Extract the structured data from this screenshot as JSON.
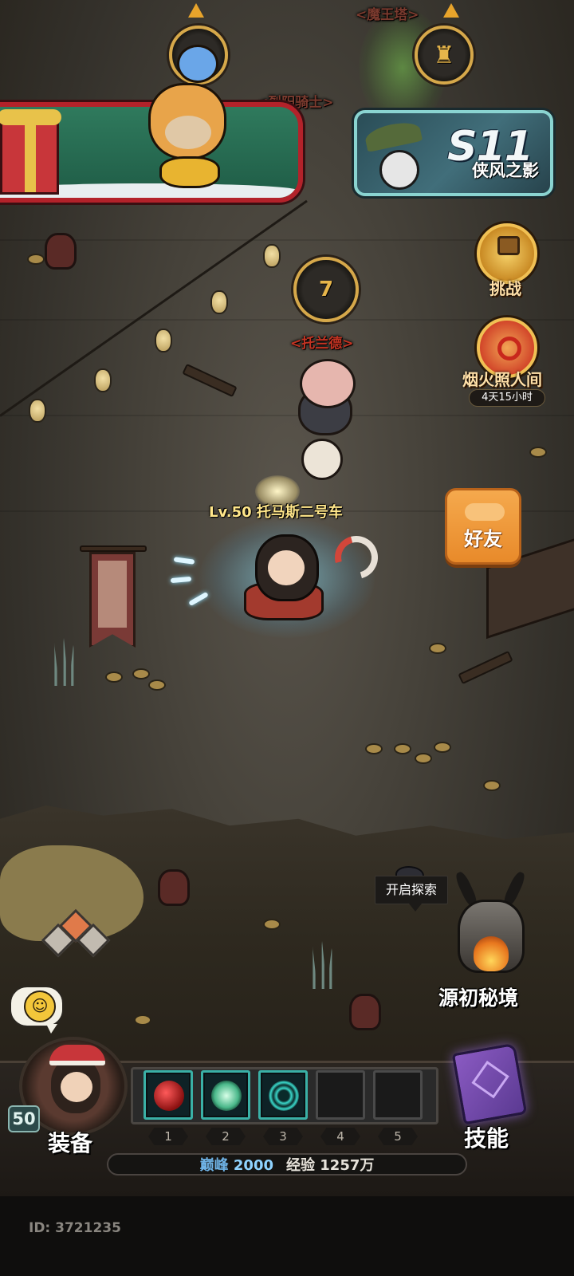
{
  "top": {
    "demon_tower_label": "<魔王塔>",
    "knight_label": "<烈阳骑士>",
    "tolande_label": "<托兰德>"
  },
  "season": {
    "code": "S11",
    "name": "侠风之影"
  },
  "events": {
    "challenge_label": "挑战",
    "fireworks_label": "烟火照人间",
    "fireworks_timer": "4天15小时"
  },
  "friends": {
    "label": "好友"
  },
  "player": {
    "name": "Lv.50 托马斯二号车",
    "level_badge": "50",
    "id": "ID: 3721235"
  },
  "explore": {
    "tooltip": "开启探索",
    "realm_label": "源初秘境"
  },
  "bottom": {
    "equip_label": "装备",
    "skill_label": "技能",
    "slots": [
      {
        "number": "1",
        "filled": true,
        "icon": "red-orb-icon"
      },
      {
        "number": "2",
        "filled": true,
        "icon": "green-lotus-icon"
      },
      {
        "number": "3",
        "filled": true,
        "icon": "cyan-vortex-icon"
      },
      {
        "number": "4",
        "filled": false,
        "icon": ""
      },
      {
        "number": "5",
        "filled": false,
        "icon": ""
      }
    ],
    "stats": {
      "peak_key": "巅峰",
      "peak_value": "2000",
      "exp_key": "经验",
      "exp_value": "1257万"
    }
  },
  "chat": {
    "icon": "smiley-icon"
  },
  "colors": {
    "accent_gold": "#d6a84a",
    "label_red": "#c23322",
    "name_yellow": "#ffe68a",
    "friends_orange": "#f5a94d",
    "season_teal": "#8ad4d1"
  }
}
